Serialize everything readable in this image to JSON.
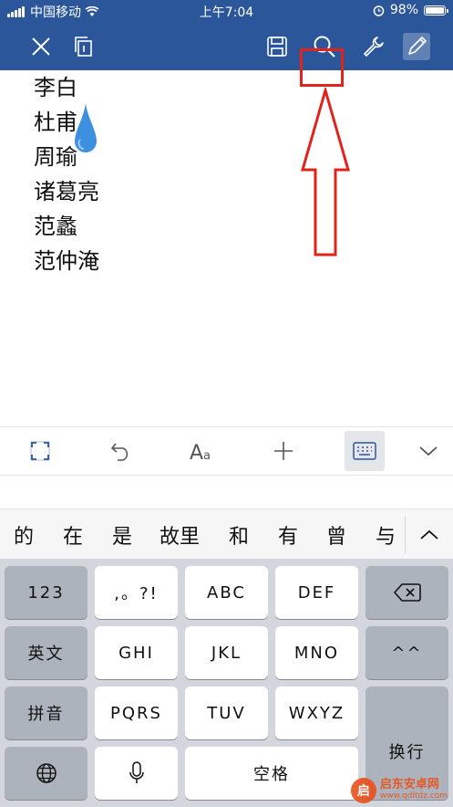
{
  "status": {
    "carrier": "中国移动",
    "time": "上午7:04",
    "battery": "98%"
  },
  "document": {
    "lines": [
      "李白",
      "杜甫",
      "周瑜",
      "诸葛亮",
      "范蠡",
      "范仲淹"
    ]
  },
  "candidates": [
    "的",
    "在",
    "是",
    "故里",
    "和",
    "有",
    "曾",
    "与"
  ],
  "keyboard": {
    "num": "123",
    "punct": ",。?!",
    "abc": "ABC",
    "def": "DEF",
    "en": "英文",
    "ghi": "GHI",
    "jkl": "JKL",
    "mno": "MNO",
    "tone": "^^",
    "pinyin": "拼音",
    "pqrs": "PQRS",
    "tuv": "TUV",
    "wxyz": "WXYZ",
    "enter": "换行",
    "space": "空格"
  },
  "watermark": {
    "title": "启东安卓网",
    "url": "www.qdltdz.com",
    "mark": "启"
  },
  "colors": {
    "ribbon": "#2b579a",
    "annotation": "#e0241c",
    "drop": "#3d8fe0"
  }
}
